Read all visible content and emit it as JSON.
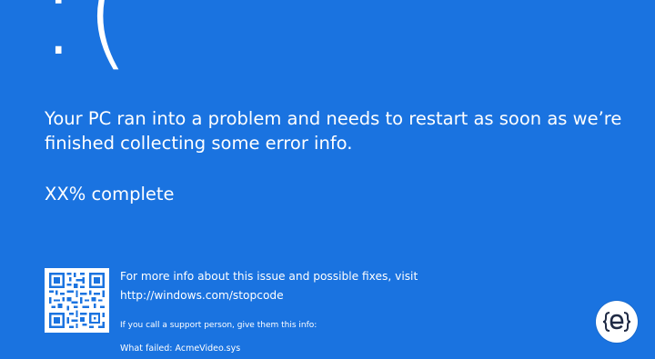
{
  "screen": {
    "background_color": "#1a73e0",
    "frown_face": ":(",
    "headline": "Your PC ran into a problem and needs to restart as soon as we’re finished collecting some error info.",
    "progress_text": "XX% complete"
  },
  "more_info": {
    "line1": "For more info about this issue and possible fixes, visit",
    "url": "http://windows.com/stopcode",
    "qr_code_icon": "qr-code-icon"
  },
  "support": {
    "prompt": "If you call a support person, give them this info:",
    "what_failed": "What failed: AcmeVideo.sys"
  },
  "watermark": {
    "icon": "e-logo-icon"
  }
}
